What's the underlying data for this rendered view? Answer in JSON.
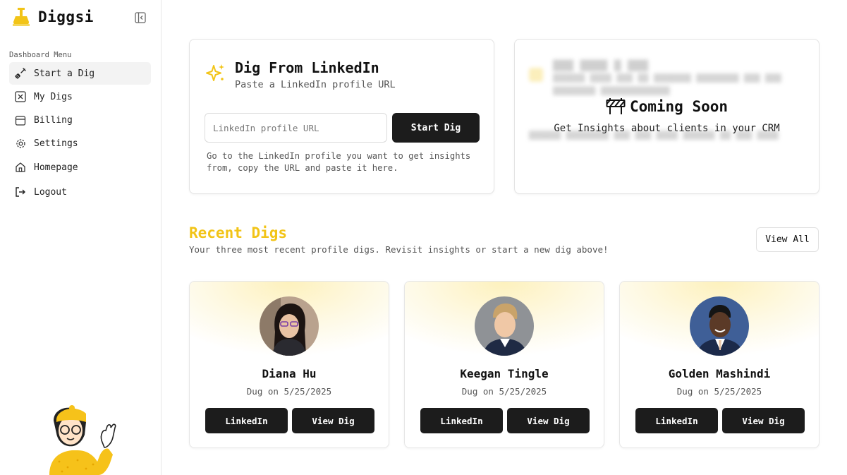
{
  "brand": {
    "name": "Diggsi",
    "logo_icon": "shovel-logo-icon",
    "accent": "#f2c417"
  },
  "sidebar": {
    "caption": "Dashboard Menu",
    "items": [
      {
        "label": "Start a Dig",
        "icon": "shovel-icon",
        "active": true
      },
      {
        "label": "My Digs",
        "icon": "x-square-icon"
      },
      {
        "label": "Billing",
        "icon": "wallet-icon"
      },
      {
        "label": "Settings",
        "icon": "gear-icon"
      },
      {
        "label": "Homepage",
        "icon": "home-icon"
      },
      {
        "label": "Logout",
        "icon": "logout-icon"
      }
    ]
  },
  "linkedin_card": {
    "title": "Dig From LinkedIn",
    "subtitle": "Paste a LinkedIn profile URL",
    "input_placeholder": "LinkedIn profile URL",
    "button": "Start Dig",
    "help": "Go to the LinkedIn profile you want to get insights from, copy the URL and paste it here."
  },
  "crm_card": {
    "title": "Coming Soon",
    "subtitle": "Get Insights about clients in your CRM"
  },
  "recent": {
    "title": "Recent Digs",
    "subtitle": "Your three most recent profile digs. Revisit insights or start a new dig above!",
    "view_all": "View All",
    "cards": [
      {
        "name": "Diana Hu",
        "date": "Dug on 5/25/2025",
        "linkedin": "LinkedIn",
        "view": "View Dig"
      },
      {
        "name": "Keegan Tingle",
        "date": "Dug on 5/25/2025",
        "linkedin": "LinkedIn",
        "view": "View Dig"
      },
      {
        "name": "Golden Mashindi",
        "date": "Dug on 5/25/2025",
        "linkedin": "LinkedIn",
        "view": "View Dig"
      }
    ]
  }
}
